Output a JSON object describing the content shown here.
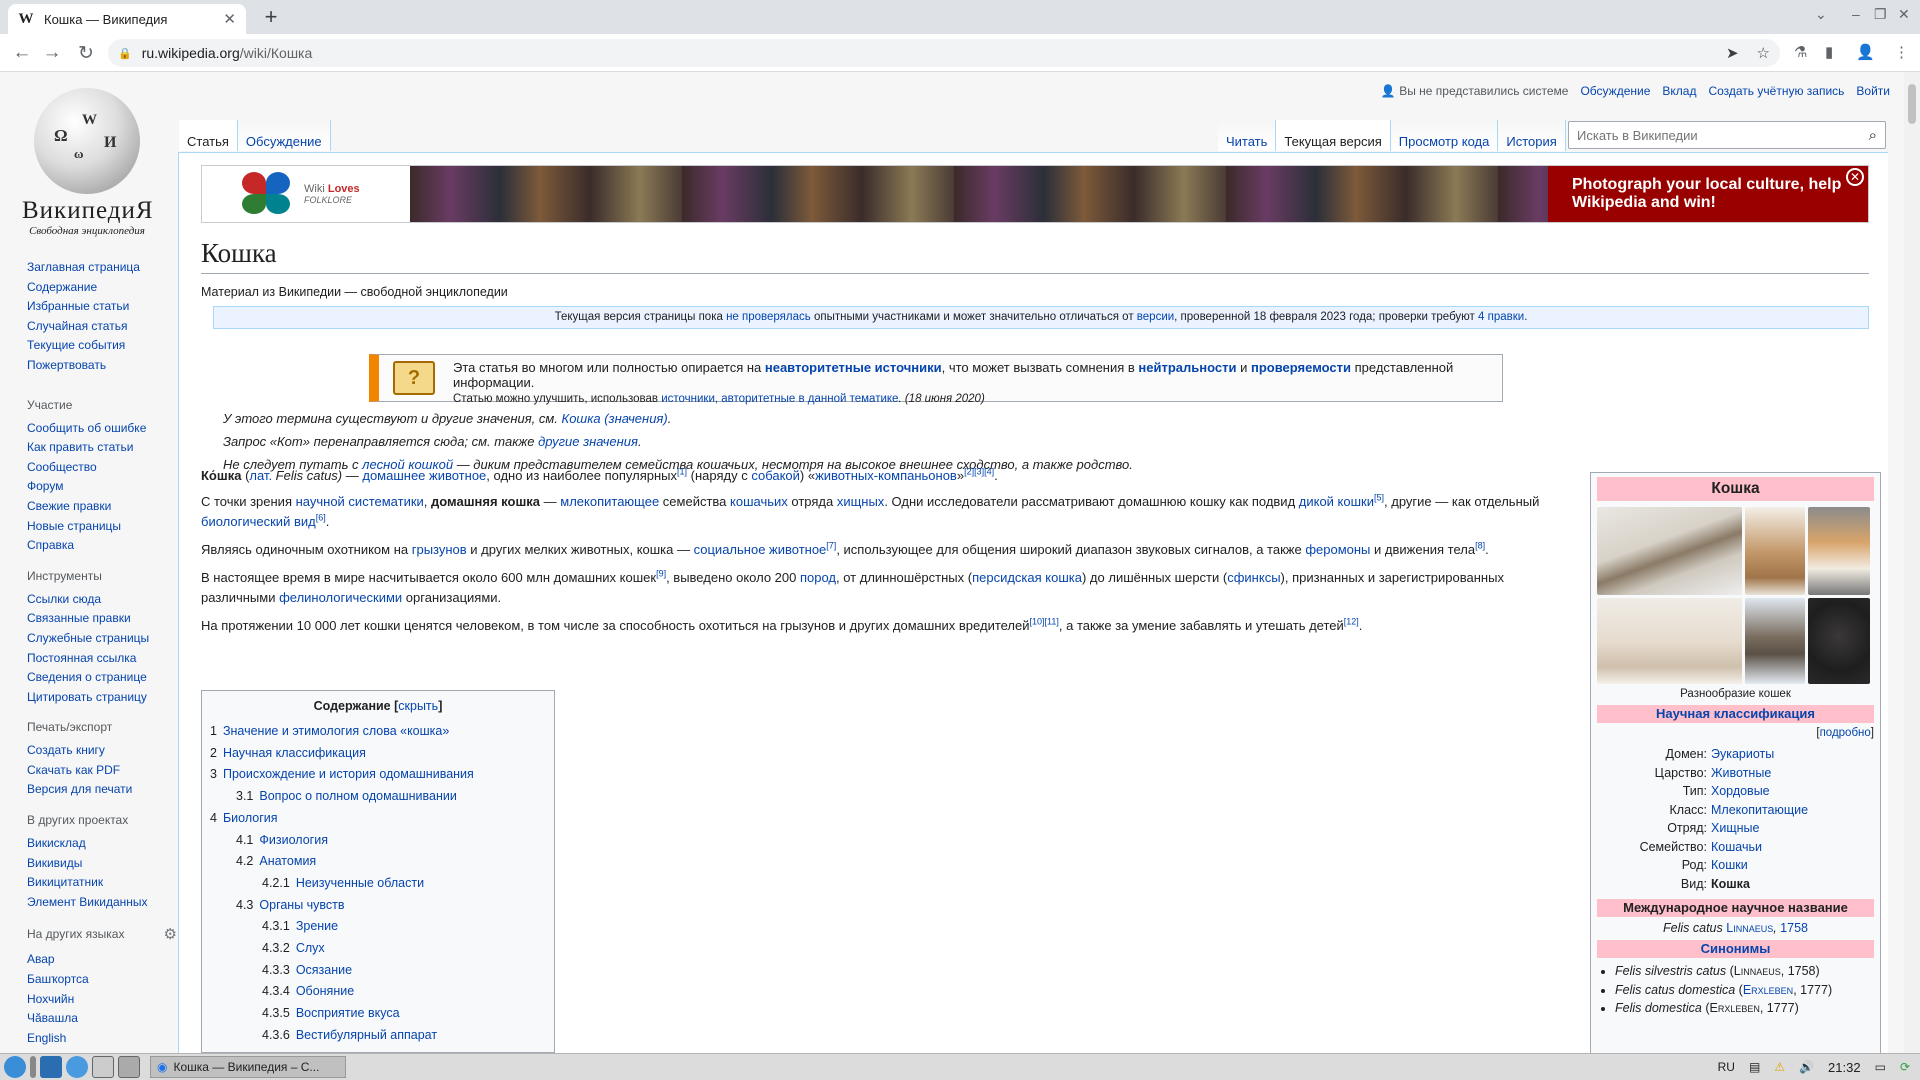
{
  "browser": {
    "tab_title": "Кошка — Википедия",
    "tab_favicon": "W",
    "new_tab": "+",
    "url_host": "ru.wikipedia.org",
    "url_path": "/wiki/Кошка"
  },
  "logo": {
    "wordmark": "ВикипедиЯ",
    "tagline": "Свободная энциклопедия"
  },
  "sidebar": {
    "main": [
      "Заглавная страница",
      "Содержание",
      "Избранные статьи",
      "Случайная статья",
      "Текущие события",
      "Пожертвовать"
    ],
    "participation": {
      "heading": "Участие",
      "items": [
        "Сообщить об ошибке",
        "Как править статьи",
        "Сообщество",
        "Форум",
        "Свежие правки",
        "Новые страницы",
        "Справка"
      ]
    },
    "tools": {
      "heading": "Инструменты",
      "items": [
        "Ссылки сюда",
        "Связанные правки",
        "Служебные страницы",
        "Постоянная ссылка",
        "Сведения о странице",
        "Цитировать страницу"
      ]
    },
    "print": {
      "heading": "Печать/экспорт",
      "items": [
        "Создать книгу",
        "Скачать как PDF",
        "Версия для печати"
      ]
    },
    "projects": {
      "heading": "В других проектах",
      "items": [
        "Викисклад",
        "Викивиды",
        "Викицитатник",
        "Элемент Викиданных"
      ]
    },
    "languages": {
      "heading": "На других языках",
      "items": [
        "Авар",
        "Башҡортса",
        "Нохчийн",
        "Чӑвашла",
        "English"
      ]
    }
  },
  "personal": {
    "anon": "Вы не представились системе",
    "links": [
      "Обсуждение",
      "Вклад",
      "Создать учётную запись",
      "Войти"
    ]
  },
  "tabs": {
    "left": [
      "Статья",
      "Обсуждение"
    ],
    "right": [
      "Читать",
      "Текущая версия",
      "Просмотр кода",
      "История"
    ]
  },
  "search": {
    "placeholder": "Искать в Википедии"
  },
  "banner": {
    "logo_line1": "Wiki",
    "logo_line1b": "Loves",
    "logo_line2": "FOLKLORE",
    "cta": "Photograph your local culture, help Wikipedia and win!"
  },
  "article": {
    "title": "Кошка",
    "subtitle": "Материал из Википедии — свободной энциклопедии",
    "flagged": {
      "t1": "Текущая версия страницы пока ",
      "l1": "не проверялась",
      "t2": " опытными участниками и может значительно отличаться от ",
      "l2": "версии",
      "t3": ", проверенной 18 февраля 2023 года; проверки требуют ",
      "l3": "4 правки",
      "t4": "."
    },
    "ambox": {
      "t1": "Эта статья во многом или полностью опирается на ",
      "l1": "неавторитетные источники",
      "t2": ", что может вызвать сомнения в ",
      "l2": "нейтральности",
      "t3": " и ",
      "l3": "проверяемости",
      "t4": " представленной информации.",
      "s1": "Статью можно улучшить, использовав ",
      "sl": "источники, авторитетные в данной тематике",
      "s2": ". (18 июня 2020)"
    },
    "hatnotes": {
      "h1a": "У этого термина существуют и другие значения, см. ",
      "h1l": "Кошка (значения)",
      "h1b": ".",
      "h2a": "Запрос «Кот» перенаправляется сюда; см. также ",
      "h2l": "другие значения",
      "h2b": ".",
      "h3a": "Не следует путать с ",
      "h3l": "лесной кошкой",
      "h3b": " — диким представителем семейства кошачьих, несмотря на высокое внешнее сходство, а также родство."
    },
    "p1": {
      "b": "Ко́шка",
      "t1": " (",
      "l1": "лат.",
      "t2": " Felis catus) — ",
      "l2": "домашнее животное",
      "t3": ", одно из наиболее популярных",
      "s1": "[1]",
      "t4": " (наряду с ",
      "l3": "собакой",
      "t5": ") «",
      "l4": "животных-компаньонов",
      "t6": "»",
      "s2": "[2][3][4]",
      "t7": "."
    },
    "p2": {
      "t1": "С точки зрения ",
      "l1": "научной систематики",
      "t2": ", ",
      "b": "домашняя кошка",
      "t3": " — ",
      "l2": "млекопитающее",
      "t4": " семейства ",
      "l3": "кошачьих",
      "t5": " отряда ",
      "l4": "хищных",
      "t6": ". Одни исследователи рассматривают домашнюю кошку как подвид ",
      "l5": "дикой кошки",
      "s1": "[5]",
      "t7": ", другие — как отдельный ",
      "l6": "биологический вид",
      "s2": "[6]",
      "t8": "."
    },
    "p3": {
      "t1": "Являясь одиночным охотником на ",
      "l1": "грызунов",
      "t2": " и других мелких животных, кошка — ",
      "l2": "социальное животное",
      "s1": "[7]",
      "t3": ", использующее для общения широкий диапазон звуковых сигналов, а также ",
      "l3": "феромоны",
      "t4": " и движения тела",
      "s2": "[8]",
      "t5": "."
    },
    "p4": {
      "t1": "В настоящее время в мире насчитывается около 600 млн домашних кошек",
      "s1": "[9]",
      "t2": ", выведено около 200 ",
      "l1": "пород",
      "t3": ", от длинношёрстных (",
      "l2": "персидская кошка",
      "t4": ") до лишённых шерсти (",
      "l3": "сфинксы",
      "t5": "), признанных и зарегистрированных различными ",
      "l4": "фелинологическими",
      "t6": " организациями."
    },
    "p5": {
      "t1": "На протяжении 10 000 лет кошки ценятся человеком, в том числе за способность охотиться на грызунов и других домашних вредителей",
      "s1": "[10][11]",
      "t2": ", а также за умение забавлять и утешать детей",
      "s2": "[12]",
      "t3": "."
    }
  },
  "toc": {
    "title": "Содержание",
    "hide": "скрыть",
    "items": [
      {
        "n": "1",
        "t": "Значение и этимология слова «кошка»",
        "lvl": 1
      },
      {
        "n": "2",
        "t": "Научная классификация",
        "lvl": 1
      },
      {
        "n": "3",
        "t": "Происхождение и история одомашнивания",
        "lvl": 1
      },
      {
        "n": "3.1",
        "t": "Вопрос о полном одомашнивании",
        "lvl": 2
      },
      {
        "n": "4",
        "t": "Биология",
        "lvl": 1
      },
      {
        "n": "4.1",
        "t": "Физиология",
        "lvl": 2
      },
      {
        "n": "4.2",
        "t": "Анатомия",
        "lvl": 2
      },
      {
        "n": "4.2.1",
        "t": "Неизученные области",
        "lvl": 3
      },
      {
        "n": "4.3",
        "t": "Органы чувств",
        "lvl": 2
      },
      {
        "n": "4.3.1",
        "t": "Зрение",
        "lvl": 3
      },
      {
        "n": "4.3.2",
        "t": "Слух",
        "lvl": 3
      },
      {
        "n": "4.3.3",
        "t": "Осязание",
        "lvl": 3
      },
      {
        "n": "4.3.4",
        "t": "Обоняние",
        "lvl": 3
      },
      {
        "n": "4.3.5",
        "t": "Восприятие вкуса",
        "lvl": 3
      },
      {
        "n": "4.3.6",
        "t": "Вестибулярный аппарат",
        "lvl": 3
      }
    ]
  },
  "infobox": {
    "title": "Кошка",
    "caption": "Разнообразие кошек",
    "sec_class": "Научная классификация",
    "more": "подробно",
    "rows": [
      {
        "k": "Домен:",
        "v": "Эукариоты",
        "link": true
      },
      {
        "k": "Царство:",
        "v": "Животные",
        "link": true
      },
      {
        "k": "Тип:",
        "v": "Хордовые",
        "link": true
      },
      {
        "k": "Класс:",
        "v": "Млекопитающие",
        "link": true
      },
      {
        "k": "Отряд:",
        "v": "Хищные",
        "link": true
      },
      {
        "k": "Семейство:",
        "v": "Кошачьи",
        "link": true
      },
      {
        "k": "Род:",
        "v": "Кошки",
        "link": true
      },
      {
        "k": "Вид:",
        "v": "Кошка",
        "link": false
      }
    ],
    "sec_name": "Международное научное название",
    "sci_name": "Felis catus",
    "sci_author": "Linnaeus",
    "sci_year": "1758",
    "sec_syn": "Синонимы",
    "synonyms": [
      {
        "name": "Felis silvestris catus",
        "auth": "Linnaeus",
        "year": "1758"
      },
      {
        "name": "Felis catus domestica",
        "auth": "Erxleben",
        "year": "1777"
      },
      {
        "name": "Felis domestica",
        "auth": "Erxleben",
        "year": "1777"
      }
    ]
  },
  "taskbar": {
    "task_title": "Кошка — Википедия – C...",
    "lang": "RU",
    "clock": "21:32"
  },
  "colors": {
    "link": "#0645ad",
    "infobox_header": "#ffc0cb",
    "banner_cta": "#990000",
    "ambox_stripe": "#f28500"
  }
}
